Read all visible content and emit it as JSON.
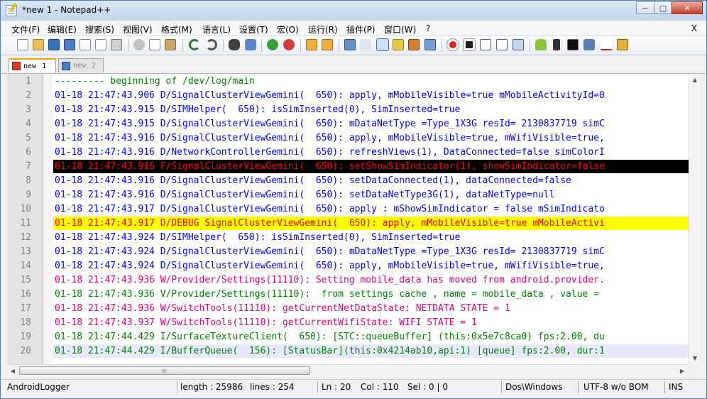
{
  "window": {
    "title": "*new  1 - Notepad++"
  },
  "window_buttons": {
    "minimize": "−",
    "maximize": "□",
    "close": "✕"
  },
  "menu": {
    "items": [
      "文件(F)",
      "编辑(E)",
      "搜索(S)",
      "视图(V)",
      "格式(M)",
      "语言(L)",
      "设置(T)",
      "宏(O)",
      "运行(R)",
      "插件(P)",
      "窗口(W)",
      "?"
    ],
    "close_label": "X"
  },
  "toolbar": {
    "icons": [
      "new-file-icon",
      "open-file-icon",
      "save-icon",
      "save-all-icon",
      "close-icon",
      "close-all-icon",
      "print-icon",
      "cut-icon",
      "copy-icon",
      "paste-icon",
      "undo-icon",
      "redo-icon",
      "find-icon",
      "replace-icon",
      "zoom-in-icon",
      "zoom-out-icon",
      "sync-vertical-icon",
      "sync-horizontal-icon",
      "word-wrap-icon",
      "show-all-chars-icon",
      "indent-guide-icon",
      "user-lang-icon",
      "doc-map-icon",
      "function-list-icon",
      "record-macro-icon",
      "stop-record-icon",
      "play-macro-icon",
      "run-macro-multiple-icon",
      "save-macro-icon",
      "android-icon",
      "phone-icon",
      "console-icon",
      "camera-icon",
      "spellcheck-icon",
      "plugin-icon"
    ]
  },
  "tabs": [
    {
      "label": "new",
      "number": "1",
      "active": true
    },
    {
      "label": "new",
      "number": "2",
      "active": false
    }
  ],
  "editor": {
    "lines": [
      {
        "n": "1",
        "text": "--------- beginning of /dev/log/main",
        "color": "#008000",
        "hl": ""
      },
      {
        "n": "2",
        "text": "01-18 21:47:43.906 D/SignalClusterViewGemini(  650): apply, mMobileVisible=true mMobileActivityId=0",
        "color": "#0000ff",
        "hl": ""
      },
      {
        "n": "3",
        "text": "01-18 21:47:43.915 D/SIMHelper(  650): isSimInserted(0), SimInserted=true",
        "color": "#0000ff",
        "hl": ""
      },
      {
        "n": "4",
        "text": "01-18 21:47:43.915 D/SignalClusterViewGemini(  650): mDataNetType =Type_1X3G resId= 2130837719 simC",
        "color": "#0000ff",
        "hl": ""
      },
      {
        "n": "5",
        "text": "01-18 21:47:43.916 D/SignalClusterViewGemini(  650): apply, mMobileVisible=true, mWifiVisible=true,",
        "color": "#0000ff",
        "hl": ""
      },
      {
        "n": "6",
        "text": "01-18 21:47:43.916 D/NetworkControllerGemini(  650): refreshViews(1), DataConnected=false simColorI",
        "color": "#0000ff",
        "hl": ""
      },
      {
        "n": "7",
        "text": "01-18 21:47:43.916 F/SignalClusterViewGemini(  650): setShowSimIndicator(1), showSimIndicator=false",
        "color": "#ff0000",
        "hl": "black"
      },
      {
        "n": "8",
        "text": "01-18 21:47:43.916 D/SignalClusterViewGemini(  650): setDataConnected(1), dataConnected=false",
        "color": "#0000ff",
        "hl": ""
      },
      {
        "n": "9",
        "text": "01-18 21:47:43.916 D/SignalClusterViewGemini(  650): setDataNetType3G(1), dataNetType=null",
        "color": "#0000ff",
        "hl": ""
      },
      {
        "n": "10",
        "text": "01-18 21:47:43.917 D/SignalClusterViewGemini(  650): apply : mShowSimIndicator = false mSimIndicato",
        "color": "#0000ff",
        "hl": ""
      },
      {
        "n": "11",
        "text": "01-18 21:47:43.917 D/DEBUG SignalClusterViewGemini(  650): apply, mMobileVisible=true mMobileActivi",
        "color": "#ff0000",
        "hl": "yellow"
      },
      {
        "n": "12",
        "text": "01-18 21:47:43.924 D/SIMHelper(  650): isSimInserted(0), SimInserted=true",
        "color": "#0000ff",
        "hl": ""
      },
      {
        "n": "13",
        "text": "01-18 21:47:43.924 D/SignalClusterViewGemini(  650): mDataNetType =Type_1X3G resId= 2130837719 simC",
        "color": "#0000ff",
        "hl": ""
      },
      {
        "n": "14",
        "text": "01-18 21:47:43.924 D/SignalClusterViewGemini(  650): apply, mMobileVisible=true, mWifiVisible=true,",
        "color": "#0000ff",
        "hl": ""
      },
      {
        "n": "15",
        "text": "01-18 21:47:43.936 W/Provider/Settings(11110): Setting mobile_data has moved from android.provider.",
        "color": "#e3007a",
        "hl": ""
      },
      {
        "n": "16",
        "text": "01-18 21:47:43.936 V/Provider/Settings(11110):  from settings cache , name = mobile_data , value = ",
        "color": "#008000",
        "hl": ""
      },
      {
        "n": "17",
        "text": "01-18 21:47:43.936 W/SwitchTools(11110): getCurrentNetDataState: NETDATA STATE = 1",
        "color": "#e3007a",
        "hl": ""
      },
      {
        "n": "18",
        "text": "01-18 21:47:43.937 W/SwitchTools(11110): getCurrentWifiState: WIFI STATE = 1",
        "color": "#e3007a",
        "hl": ""
      },
      {
        "n": "19",
        "text": "01-18 21:47:44.429 I/SurfaceTextureClient(  650): [STC::queueBuffer] (this:0x5e7c8ca0) fps:2.00, du",
        "color": "#008000",
        "hl": ""
      },
      {
        "n": "20",
        "text": "01-18 21:47:44.429 I/BufferQueue(  156): [StatusBar](this:0x4214ab10,api:1) [queue] fps:2.00, dur:1",
        "color": "#008000",
        "hl": "current"
      }
    ]
  },
  "statusbar": {
    "lexer": "AndroidLogger",
    "length": "length : 25986",
    "lines": "lines : 254",
    "ln": "Ln : 20",
    "col": "Col : 110",
    "sel": "Sel : 0 | 0",
    "eol": "Dos\\Windows",
    "encoding": "UTF-8 w/o BOM",
    "mode": "INS"
  },
  "scrollbars": {
    "horizontal_grip": "III",
    "up_arrow": "▲",
    "down_arrow": "▼",
    "left_arrow": "◀",
    "right_arrow": "▶"
  }
}
